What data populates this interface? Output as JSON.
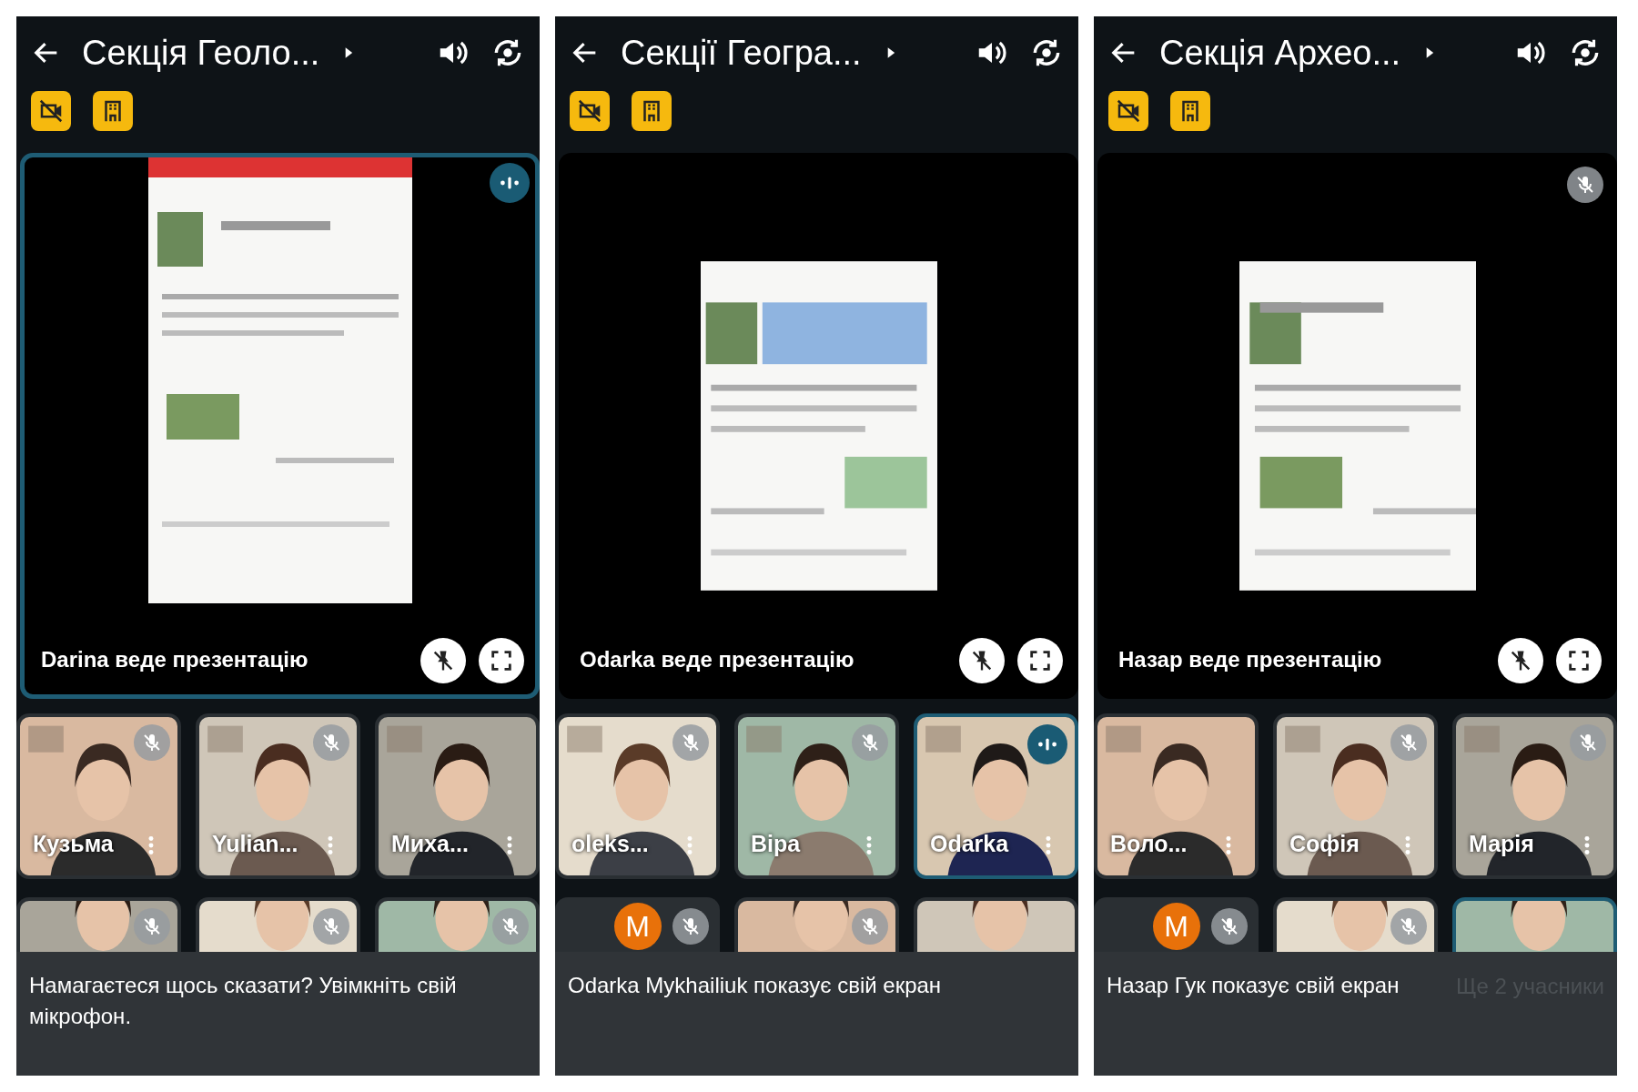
{
  "panels": [
    {
      "title": "Секція Геоло...",
      "presenter_label": "Darina веде презентацію",
      "stage_highlighted": true,
      "stage_speaking": true,
      "stage_muted": false,
      "tiles": [
        {
          "name": "Кузьма",
          "muted": true,
          "speaking": false,
          "highlighted": false
        },
        {
          "name": "Yulian...",
          "muted": true,
          "speaking": false,
          "highlighted": false
        },
        {
          "name": "Миха...",
          "muted": false,
          "speaking": false,
          "highlighted": false
        }
      ],
      "tiles_row2": [
        {
          "kind": "video",
          "muted": true,
          "highlighted": false
        },
        {
          "kind": "video",
          "muted": true,
          "highlighted": false
        },
        {
          "kind": "video",
          "muted": true,
          "highlighted": false
        }
      ],
      "toast": {
        "text": "Намагаєтеся щось сказати? Увімкніть свій мікрофон."
      }
    },
    {
      "title": "Секції Геогра...",
      "presenter_label": "Odarka веде презентацію",
      "stage_highlighted": false,
      "stage_speaking": false,
      "stage_muted": false,
      "tiles": [
        {
          "name": "oleks...",
          "muted": true,
          "speaking": false,
          "highlighted": false
        },
        {
          "name": "Віра",
          "muted": true,
          "speaking": false,
          "highlighted": false
        },
        {
          "name": "Odarka",
          "muted": false,
          "speaking": true,
          "highlighted": true
        }
      ],
      "tiles_row2": [
        {
          "kind": "avatar",
          "initial": "M",
          "muted": true,
          "highlighted": false
        },
        {
          "kind": "video",
          "muted": true,
          "highlighted": false
        },
        {
          "kind": "video",
          "muted": false,
          "highlighted": false
        }
      ],
      "toast": {
        "text": "Odarka Mykhailiuk показує свій екран"
      }
    },
    {
      "title": "Секція Архео...",
      "presenter_label": "Назар веде презентацію",
      "stage_highlighted": false,
      "stage_speaking": false,
      "stage_muted": true,
      "tiles": [
        {
          "name": "Воло...",
          "muted": false,
          "speaking": false,
          "highlighted": false
        },
        {
          "name": "Софія",
          "muted": true,
          "speaking": false,
          "highlighted": false
        },
        {
          "name": "Марія",
          "muted": true,
          "speaking": false,
          "highlighted": false
        }
      ],
      "tiles_row2": [
        {
          "kind": "avatar",
          "initial": "M",
          "muted": true,
          "highlighted": false
        },
        {
          "kind": "video",
          "muted": true,
          "highlighted": false
        },
        {
          "kind": "video",
          "muted": false,
          "highlighted": true
        }
      ],
      "toast": {
        "text": "Назар Гук показує свій екран",
        "extra": "Ще 2 учасники"
      }
    }
  ]
}
